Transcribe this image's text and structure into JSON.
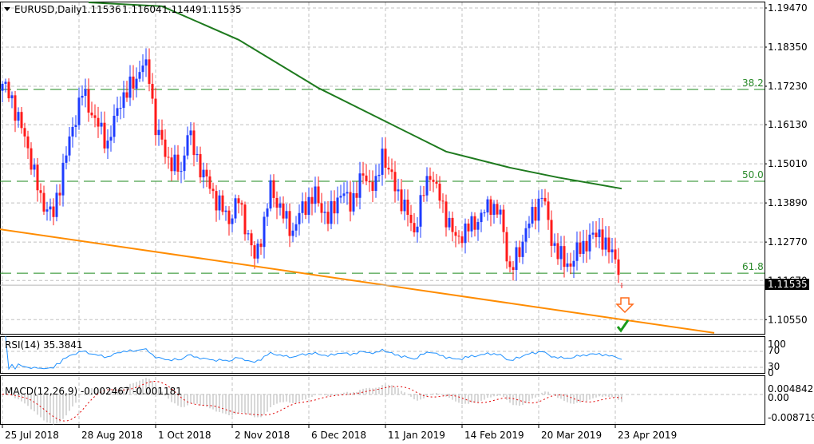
{
  "header": {
    "symbol_tf": "EURUSD,Daily",
    "open": "1.11536",
    "high": "1.11604",
    "low": "1.11449",
    "close": "1.11535"
  },
  "price_axis": [
    "1.19470",
    "1.18350",
    "1.17230",
    "1.16130",
    "1.15010",
    "1.13890",
    "1.12770",
    "1.11670",
    "1.10550"
  ],
  "current_price_label": "1.11535",
  "fib_levels": [
    {
      "label": "38.2",
      "price": 1.1714
    },
    {
      "label": "50.0",
      "price": 1.1451
    },
    {
      "label": "61.8",
      "price": 1.1188
    }
  ],
  "rsi": {
    "label": "RSI(14) 35.3841",
    "axis": [
      "100",
      "70",
      "30",
      "0"
    ]
  },
  "macd": {
    "label": "MACD(12,26,9) -0.002467 -0.001181",
    "axis": [
      "0.004842",
      "0.00",
      "-0.008719"
    ]
  },
  "date_axis": [
    "25 Jul 2018",
    "28 Aug 2018",
    "1 Oct 2018",
    "2 Nov 2018",
    "6 Dec 2018",
    "11 Jan 2019",
    "14 Feb 2019",
    "20 Mar 2019",
    "23 Apr 2019"
  ],
  "colors": {
    "bull": "#1e3cff",
    "bear": "#ff1a1a",
    "ma": "#1e7a1e",
    "trend": "#ff8c00",
    "fib": "#1e8a1e",
    "rsi": "#1e90ff",
    "macd_hist": "#b0b0b0",
    "macd_signal": "#e00000",
    "check": "#1a9a1a"
  },
  "chart_data": {
    "type": "candlestick",
    "title": "EURUSD,Daily",
    "ylim": [
      1.0985,
      1.1985
    ],
    "close_path_day_price": [
      [
        0,
        1.173
      ],
      [
        3,
        1.1684
      ],
      [
        8,
        1.1547
      ],
      [
        12,
        1.1398
      ],
      [
        16,
        1.1353
      ],
      [
        19,
        1.149
      ],
      [
        22,
        1.1604
      ],
      [
        25,
        1.1707
      ],
      [
        29,
        1.1627
      ],
      [
        33,
        1.1558
      ],
      [
        37,
        1.1684
      ],
      [
        41,
        1.173
      ],
      [
        44,
        1.1787
      ],
      [
        46,
        1.1753
      ],
      [
        48,
        1.1604
      ],
      [
        52,
        1.1513
      ],
      [
        56,
        1.1478
      ],
      [
        58,
        1.1593
      ],
      [
        62,
        1.149
      ],
      [
        67,
        1.1398
      ],
      [
        71,
        1.1341
      ],
      [
        74,
        1.1398
      ],
      [
        79,
        1.1227
      ],
      [
        82,
        1.133
      ],
      [
        84,
        1.1433
      ],
      [
        88,
        1.1353
      ],
      [
        91,
        1.1307
      ],
      [
        94,
        1.1376
      ],
      [
        98,
        1.141
      ],
      [
        102,
        1.1341
      ],
      [
        106,
        1.1421
      ],
      [
        109,
        1.1387
      ],
      [
        113,
        1.1467
      ],
      [
        117,
        1.1433
      ],
      [
        119,
        1.1536
      ],
      [
        122,
        1.1456
      ],
      [
        126,
        1.1376
      ],
      [
        129,
        1.1307
      ],
      [
        132,
        1.1421
      ],
      [
        134,
        1.1478
      ],
      [
        138,
        1.1376
      ],
      [
        142,
        1.1284
      ],
      [
        146,
        1.1318
      ],
      [
        149,
        1.1341
      ],
      [
        153,
        1.1387
      ],
      [
        156,
        1.1353
      ],
      [
        159,
        1.1193
      ],
      [
        162,
        1.125
      ],
      [
        164,
        1.1318
      ],
      [
        167,
        1.1364
      ],
      [
        169,
        1.1421
      ],
      [
        172,
        1.1284
      ],
      [
        176,
        1.1216
      ],
      [
        178,
        1.1216
      ],
      [
        181,
        1.1261
      ],
      [
        184,
        1.1284
      ],
      [
        187,
        1.1307
      ],
      [
        189,
        1.1261
      ],
      [
        192,
        1.124
      ],
      [
        194,
        1.11535
      ]
    ],
    "ma200_day_price": [
      [
        27,
        1.1985
      ],
      [
        50,
        1.1952
      ],
      [
        74,
        1.1856
      ],
      [
        99,
        1.1718
      ],
      [
        119,
        1.1627
      ],
      [
        139,
        1.1536
      ],
      [
        159,
        1.149
      ],
      [
        174,
        1.1462
      ],
      [
        194,
        1.143
      ]
    ],
    "trendline_day_price": [
      [
        -1,
        1.1314
      ],
      [
        223,
        1.1017
      ]
    ],
    "date_tick_days": [
      0,
      24,
      48,
      72,
      96,
      120,
      144,
      168,
      192
    ]
  }
}
